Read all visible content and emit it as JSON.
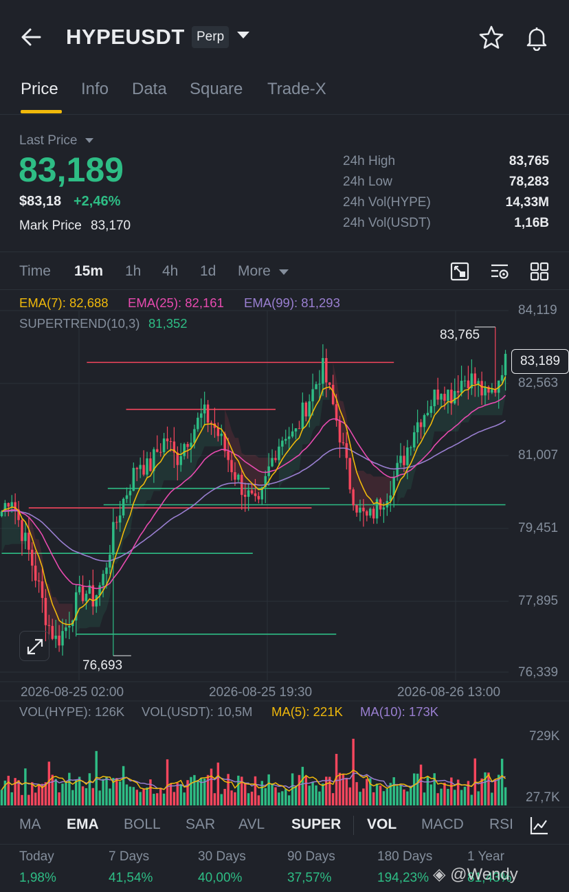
{
  "header": {
    "pair": "HYPEUSDT",
    "badge": "Perp"
  },
  "tabs": [
    "Price",
    "Info",
    "Data",
    "Square",
    "Trade-X"
  ],
  "price": {
    "last_price_label": "Last Price",
    "last_price": "83,189",
    "usd": "$83,18",
    "change": "+2,46%",
    "mark_label": "Mark Price",
    "mark_value": "83,170"
  },
  "stats": [
    {
      "label": "24h High",
      "value": "83,765"
    },
    {
      "label": "24h Low",
      "value": "78,283"
    },
    {
      "label": "24h Vol(HYPE)",
      "value": "14,33M"
    },
    {
      "label": "24h Vol(USDT)",
      "value": "1,16B"
    }
  ],
  "intervals": [
    "Time",
    "15m",
    "1h",
    "4h",
    "1d",
    "More"
  ],
  "legends": {
    "ema7": "EMA(7): 82,688",
    "ema25": "EMA(25): 82,161",
    "ema99": "EMA(99): 81,293",
    "supertrend_label": "SUPERTREND(10,3)",
    "supertrend_value": "81,352"
  },
  "price_axis": [
    "84,119",
    "82,563",
    "81,007",
    "79,451",
    "77,895",
    "76,339"
  ],
  "current_price_tag": "83,189",
  "high_marker": "83,765",
  "low_marker": "76,693",
  "time_axis": [
    "2026-08-25 02:00",
    "2026-08-25 19:30",
    "2026-08-26 13:00"
  ],
  "volume_legend": {
    "vol_hype": "VOL(HYPE): 126K",
    "vol_usdt": "VOL(USDT): 10,5M",
    "ma5": "MA(5): 221K",
    "ma10": "MA(10): 173K"
  },
  "volume_axis": [
    "729K",
    "27,7K"
  ],
  "indicator_tabs": [
    "MA",
    "EMA",
    "BOLL",
    "SAR",
    "AVL",
    "SUPER",
    "VOL",
    "MACD",
    "RSI"
  ],
  "performance": [
    {
      "label": "Today",
      "value": "1,98%"
    },
    {
      "label": "7 Days",
      "value": "41,54%"
    },
    {
      "label": "30 Days",
      "value": "40,00%"
    },
    {
      "label": "90 Days",
      "value": "37,57%"
    },
    {
      "label": "180 Days",
      "value": "194,23%"
    },
    {
      "label": "1 Year",
      "value": "81,43%"
    }
  ],
  "watermark": "@Wendy",
  "colors": {
    "up": "#2ebd85",
    "down": "#f6465d",
    "ema7": "#f0b90b",
    "ema25": "#e84bb0",
    "ema99": "#9a7fd1",
    "background": "#1f2229"
  },
  "chart_data": {
    "type": "candlestick",
    "price_range": [
      76339,
      84119
    ],
    "high": 83765,
    "low": 76693,
    "last": 83189,
    "close_path": [
      79800,
      80200,
      79500,
      78900,
      78200,
      77400,
      77000,
      77300,
      77800,
      78100,
      77900,
      78300,
      79200,
      79900,
      80400,
      80900,
      80700,
      81100,
      81400,
      80900,
      81300,
      81600,
      81900,
      81700,
      81300,
      80800,
      80400,
      80100,
      79800,
      80600,
      81200,
      81500,
      81400,
      82000,
      82400,
      82900,
      82200,
      81400,
      80400,
      79800,
      79600,
      79900,
      80200,
      80600,
      81000,
      81600,
      81900,
      82200,
      82500,
      82300,
      82600,
      82700,
      82500,
      82200,
      82500,
      83200
    ],
    "volume_range": [
      27700,
      729000
    ]
  }
}
